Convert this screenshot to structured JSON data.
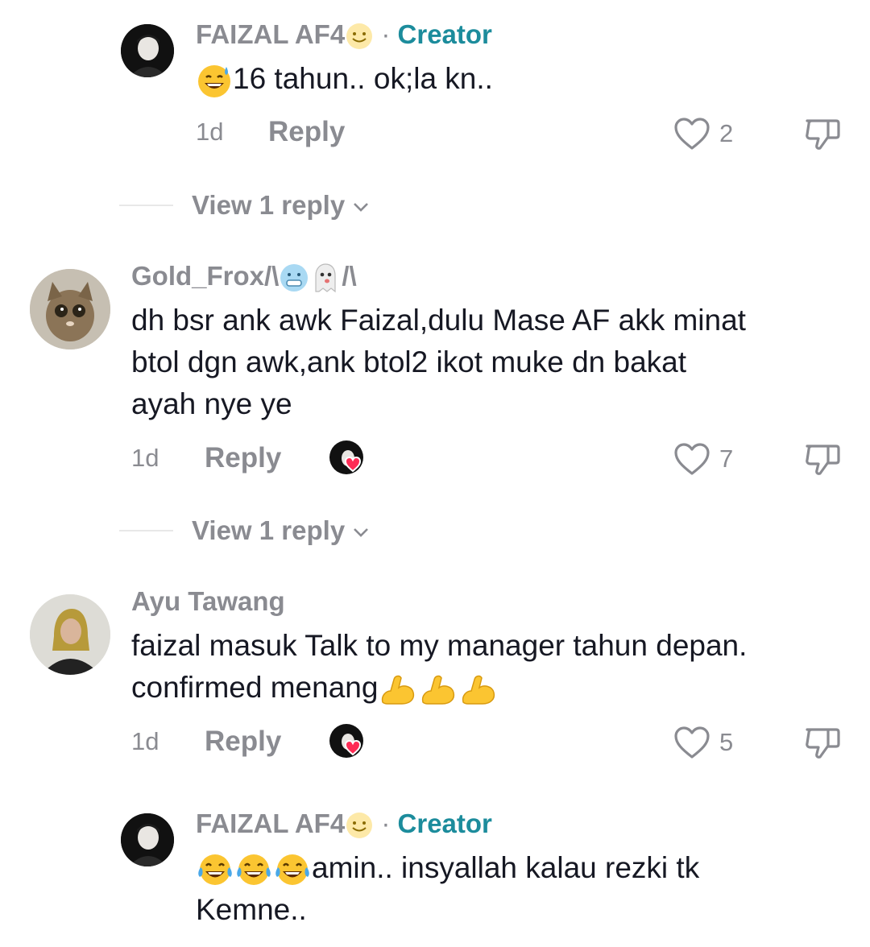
{
  "comments": [
    {
      "username": "FAIZAL AF4",
      "badge_separator": "·",
      "badge": "Creator",
      "text_lines": [
        "16 tahun.. ok;la kn.."
      ],
      "time": "1d",
      "reply_label": "Reply",
      "likes": "2",
      "view_replies": "View 1 reply"
    },
    {
      "username": "Gold_Frox/\\",
      "username_suffix": "/\\",
      "text_lines": [
        "dh bsr ank awk Faizal,dulu Mase AF akk minat",
        "btol dgn awk,ank btol2 ikot muke dn bakat",
        "ayah nye ye"
      ],
      "time": "1d",
      "reply_label": "Reply",
      "likes": "7",
      "view_replies": "View 1 reply"
    },
    {
      "username": "Ayu Tawang",
      "text_lines": [
        "faizal masuk Talk to my manager tahun depan.",
        "confirmed menang"
      ],
      "time": "1d",
      "reply_label": "Reply",
      "likes": "5"
    },
    {
      "username": "FAIZAL AF4",
      "badge_separator": "·",
      "badge": "Creator",
      "text_lines": [
        "amin.. insyallah kalau rezki tk",
        "Kemne.."
      ]
    }
  ],
  "icons": {
    "like": "heart-outline-icon",
    "dislike": "thumbs-down-icon",
    "chevron": "chevron-down-icon",
    "creator_liked": "creator-liked-heart-icon"
  },
  "colors": {
    "creator_badge": "#1c8c9c",
    "secondary_text": "#8a8b91",
    "liked_heart": "#fe2c55"
  }
}
